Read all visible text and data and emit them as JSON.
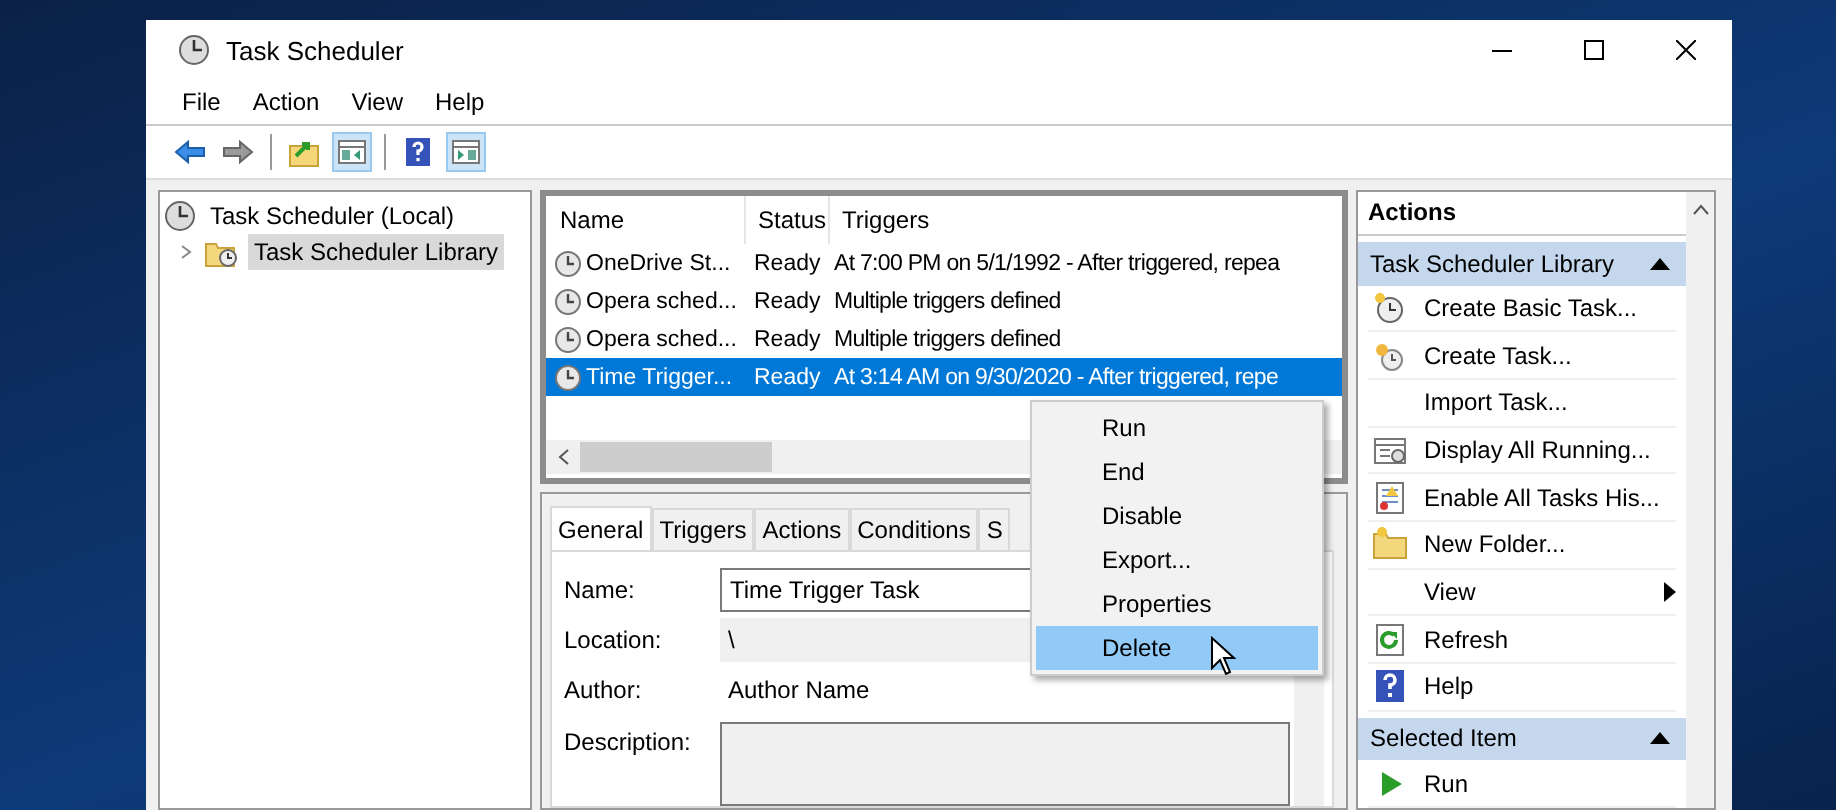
{
  "window": {
    "title": "Task Scheduler"
  },
  "menu_bar": [
    "File",
    "Action",
    "View",
    "Help"
  ],
  "toolbar": [
    {
      "kind": "back",
      "on": false
    },
    {
      "kind": "forward",
      "on": false
    },
    {
      "kind": "sep"
    },
    {
      "kind": "up-folder",
      "on": false
    },
    {
      "kind": "pane-left",
      "on": true
    },
    {
      "kind": "sep"
    },
    {
      "kind": "help",
      "on": false
    },
    {
      "kind": "pane-right",
      "on": true
    }
  ],
  "tree": [
    {
      "label": "Task Scheduler (Local)",
      "selected": false,
      "children": [
        {
          "label": "Task Scheduler Library",
          "expanded": false,
          "selected": true
        }
      ]
    }
  ],
  "tasks": {
    "columns": [
      "Name",
      "Status",
      "Triggers"
    ],
    "rows": [
      {
        "name": "OneDrive St...",
        "status": "Ready",
        "triggers": "At 7:00 PM on 5/1/1992 - After triggered, repea",
        "selected": false
      },
      {
        "name": "Opera sched...",
        "status": "Ready",
        "triggers": "Multiple triggers defined",
        "selected": false
      },
      {
        "name": "Opera sched...",
        "status": "Ready",
        "triggers": "Multiple triggers defined",
        "selected": false
      },
      {
        "name": "Time Trigger...",
        "status": "Ready",
        "triggers": "At 3:14 AM on 9/30/2020 - After triggered, repe",
        "selected": true
      }
    ]
  },
  "context_menu": [
    {
      "label": "Run",
      "selected": false
    },
    {
      "label": "End",
      "selected": false
    },
    {
      "label": "Disable",
      "selected": false
    },
    {
      "label": "Export...",
      "selected": false
    },
    {
      "label": "Properties",
      "selected": false
    },
    {
      "label": "Delete",
      "selected": true
    }
  ],
  "details": {
    "tabs": [
      {
        "label": "General",
        "selected": true
      },
      {
        "label": "Triggers",
        "selected": false
      },
      {
        "label": "Actions",
        "selected": false
      },
      {
        "label": "Conditions",
        "selected": false
      },
      {
        "label": "S",
        "selected": false
      }
    ],
    "fields": [
      {
        "kind": "input",
        "label": "Name:",
        "value": "Time Trigger Task"
      },
      {
        "kind": "text",
        "label": "Location:",
        "value": "\\"
      },
      {
        "kind": "text",
        "label": "Author:",
        "value": "Author Name"
      },
      {
        "kind": "area",
        "label": "Description:"
      }
    ]
  },
  "actions": {
    "title": "Actions",
    "sections": [
      {
        "title": "Task Scheduler Library",
        "expanded": true,
        "items": [
          {
            "label": "Create Basic Task...",
            "kind": "clock-star"
          },
          {
            "label": "Create Task...",
            "kind": "clock"
          },
          {
            "label": "Import Task...",
            "kind": "plain"
          },
          {
            "label": "Display All Running...",
            "kind": "monitor"
          },
          {
            "label": "Enable All Tasks His...",
            "kind": "list"
          },
          {
            "label": "New Folder...",
            "kind": "folder"
          },
          {
            "label": "View",
            "kind": "submenu"
          },
          {
            "label": "Refresh",
            "kind": "refresh"
          },
          {
            "label": "Help",
            "kind": "help"
          }
        ]
      },
      {
        "title": "Selected Item",
        "expanded": true,
        "items": [
          {
            "label": "Run",
            "kind": "play"
          }
        ]
      }
    ]
  }
}
